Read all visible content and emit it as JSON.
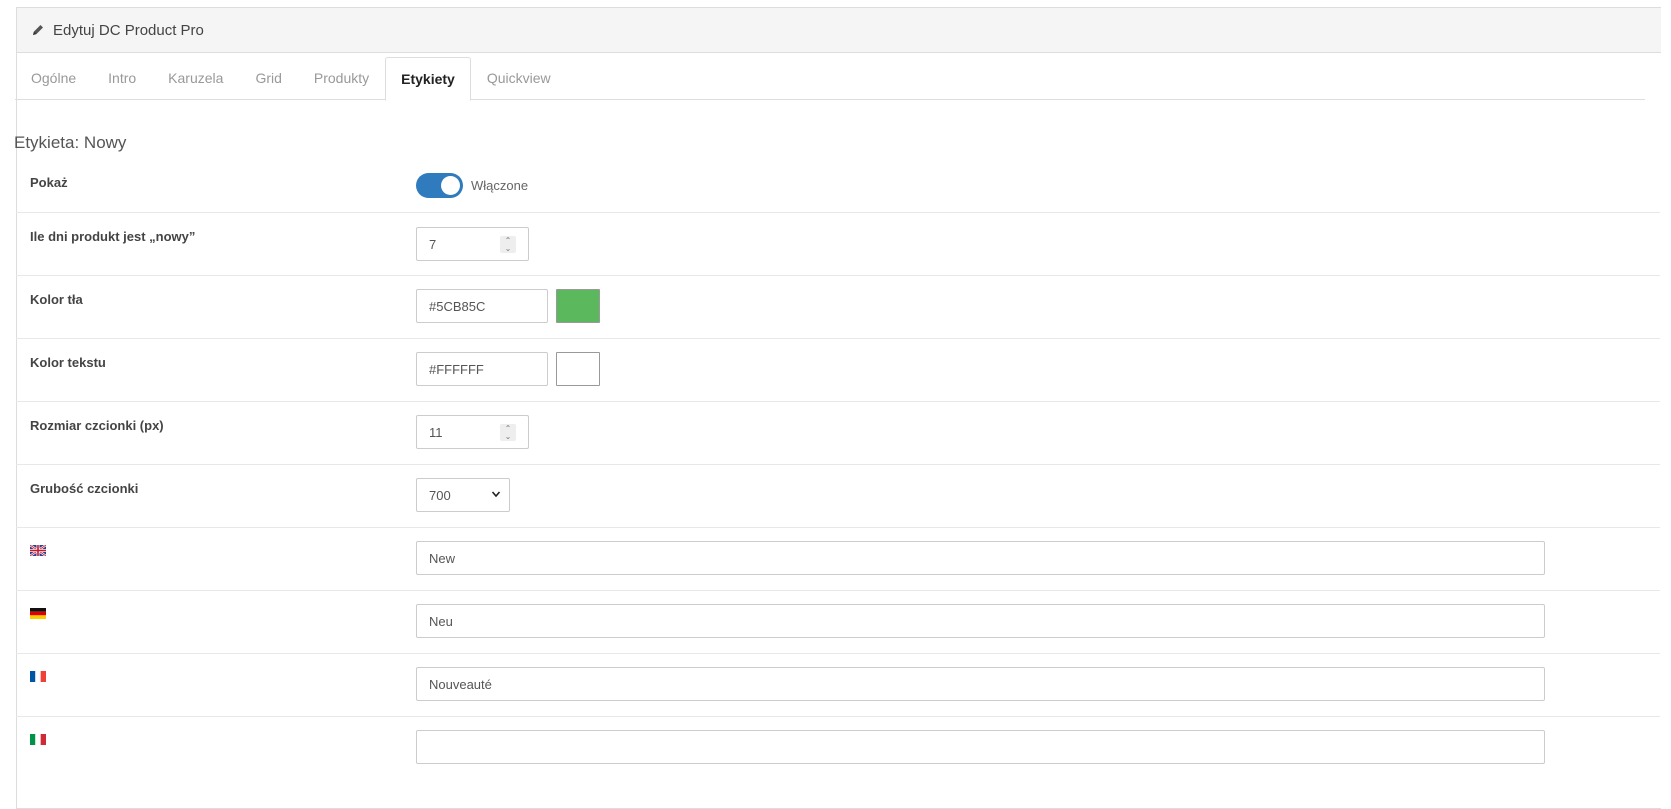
{
  "panel": {
    "title": "Edytuj DC Product Pro",
    "title_icon": "pencil-icon"
  },
  "tabs": [
    {
      "label": "Ogólne",
      "active": false
    },
    {
      "label": "Intro",
      "active": false
    },
    {
      "label": "Karuzela",
      "active": false
    },
    {
      "label": "Grid",
      "active": false
    },
    {
      "label": "Produkty",
      "active": false
    },
    {
      "label": "Etykiety",
      "active": true
    },
    {
      "label": "Quickview",
      "active": false
    }
  ],
  "section": {
    "title": "Etykieta: Nowy"
  },
  "fields": {
    "show": {
      "label": "Pokaż",
      "state_label": "Włączone",
      "enabled": true,
      "accent_color": "#2f7bbd"
    },
    "days": {
      "label": "Ile dni produkt jest „nowy”",
      "value": "7"
    },
    "bg_color": {
      "label": "Kolor tła",
      "value": "#5CB85C",
      "swatch": "#5CB85C"
    },
    "text_color": {
      "label": "Kolor tekstu",
      "value": "#FFFFFF",
      "swatch": "#FFFFFF"
    },
    "font_size": {
      "label": "Rozmiar czcionki (px)",
      "value": "11"
    },
    "font_weight": {
      "label": "Grubość czcionki",
      "value": "700"
    }
  },
  "languages": [
    {
      "flag": "uk-flag-icon",
      "value": "New"
    },
    {
      "flag": "germany-flag-icon",
      "value": "Neu"
    },
    {
      "flag": "france-flag-icon",
      "value": "Nouveauté"
    },
    {
      "flag": "italy-flag-icon",
      "value": ""
    }
  ]
}
